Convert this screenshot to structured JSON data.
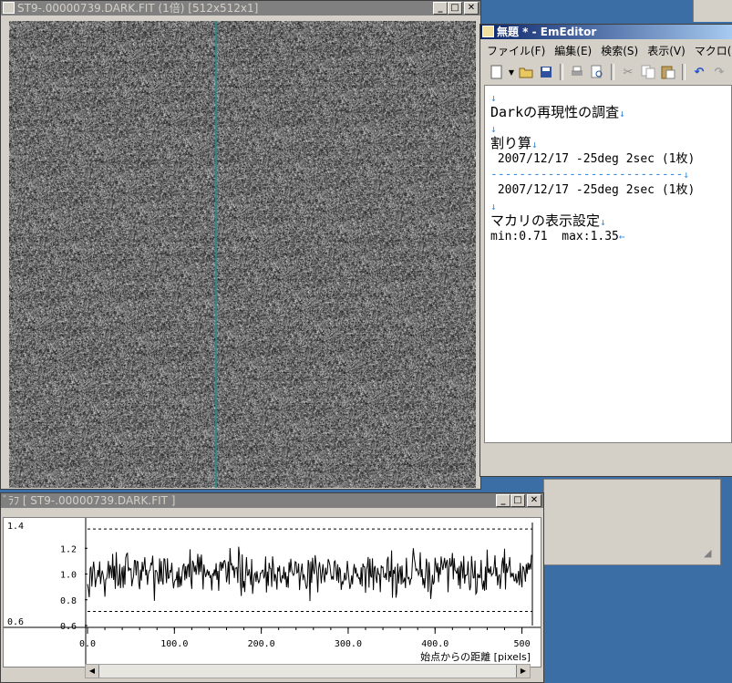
{
  "image_window": {
    "title": "ST9-.00000739.DARK.FIT (1倍) [512x512x1]",
    "btn_min": "_",
    "btn_max": "□",
    "btn_close": "✕"
  },
  "editor_window": {
    "title": "無題 * - EmEditor",
    "menu": [
      "ファイル(F)",
      "編集(E)",
      "検索(S)",
      "表示(V)",
      "マクロ(M)"
    ],
    "toolbar_icons": [
      "new-file-icon",
      "dropdown-icon",
      "open-folder-icon",
      "save-icon",
      "print-icon",
      "print-preview-icon",
      "cut-icon",
      "copy-icon",
      "paste-icon",
      "undo-icon",
      "redo-icon"
    ],
    "lines": [
      {
        "text": "",
        "mark": "↓"
      },
      {
        "text": "Darkの再現性の調査",
        "mark": "↓"
      },
      {
        "text": "",
        "mark": "↓"
      },
      {
        "text": "割り算",
        "mark": "↓"
      },
      {
        "text": " 2007/12/17 -25deg 2sec (1枚)",
        "mark": ""
      },
      {
        "text": "---------------------------",
        "mark": "↓"
      },
      {
        "text": " 2007/12/17 -25deg 2sec (1枚)",
        "mark": ""
      },
      {
        "text": "",
        "mark": "↓"
      },
      {
        "text": "マカリの表示設定",
        "mark": "↓"
      },
      {
        "text": "min:0.71  max:1.35",
        "mark": "←"
      }
    ]
  },
  "graph_window": {
    "title": "ﾞﾗﾌ [ ST9-.00000739.DARK.FIT ]",
    "btn_min": "_",
    "btn_max": "□",
    "btn_close": "✕",
    "xlabel": "始点からの距離 [pixels]"
  },
  "chart_data": {
    "type": "line",
    "xlabel": "始点からの距離 [pixels]",
    "ylabel": "",
    "xlim": [
      0,
      512
    ],
    "ylim": [
      0.6,
      1.4
    ],
    "x_ticks": [
      "0.0",
      "100.0",
      "200.0",
      "300.0",
      "400.0",
      "500"
    ],
    "y_ticks": [
      "1.2",
      "1.0",
      "0.8",
      "0.6"
    ],
    "left_scale": [
      "1.4",
      "0.6"
    ],
    "reference_lines": [
      1.35,
      0.71
    ],
    "series": [
      {
        "values_summary": "noise around 1.0, range approx 0.72-1.38",
        "sample_count": 512
      }
    ]
  },
  "colors": {
    "desktop": "#3a6ea5",
    "cursor_line": "#2b8a8a",
    "arrow_mark": "#3a8ad8"
  }
}
